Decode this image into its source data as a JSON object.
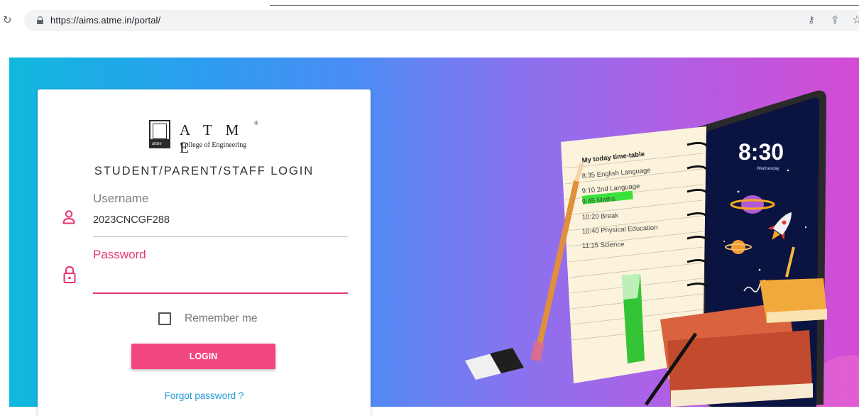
{
  "browser": {
    "url": "https://aims.atme.in/portal/"
  },
  "logo": {
    "name": "A T M E",
    "registered": "®",
    "subtitle": "College of Engineering",
    "mark_text": "atme"
  },
  "login": {
    "heading": "STUDENT/PARENT/STAFF LOGIN",
    "username_label": "Username",
    "username_value": "2023CNCGF288",
    "password_label": "Password",
    "remember_label": "Remember me",
    "login_button": "LOGIN",
    "forgot_link": "Forgot password ?"
  },
  "illustration": {
    "notebook_title": "My today time-table",
    "timetable": [
      "8:35  English Language",
      "9:10  2nd Language",
      "9:45  Maths",
      "10:20 Break",
      "10:40 Physical Education",
      "11:15  Science"
    ],
    "phone_time": "8:30",
    "phone_day": "Wednesday"
  },
  "colors": {
    "accent": "#e8336d",
    "button": "#f2467f",
    "link": "#1e9ad6",
    "highlight": "#39e23a"
  },
  "icons": [
    "reload-icon",
    "lock-icon",
    "key-icon",
    "share-icon",
    "star-icon",
    "user-icon",
    "password-lock-icon"
  ]
}
